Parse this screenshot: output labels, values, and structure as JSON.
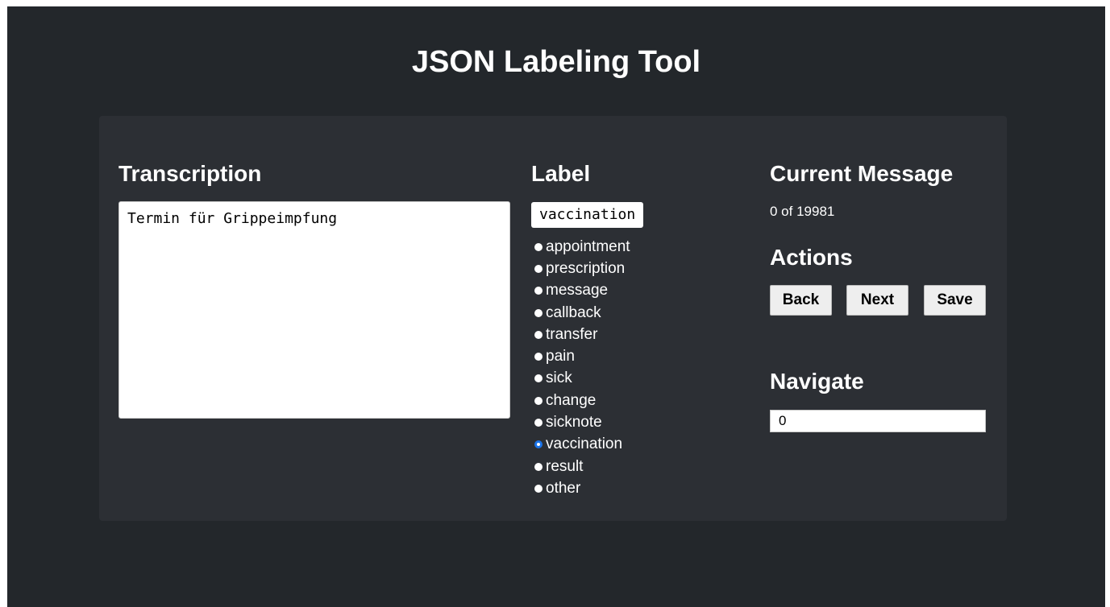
{
  "app": {
    "title": "JSON Labeling Tool"
  },
  "transcription": {
    "heading": "Transcription",
    "text": "Termin für Grippeimpfung"
  },
  "label": {
    "heading": "Label",
    "current_value": "vaccination",
    "options": [
      {
        "label": "appointment",
        "checked": false
      },
      {
        "label": "prescription",
        "checked": false
      },
      {
        "label": "message",
        "checked": false
      },
      {
        "label": "callback",
        "checked": false
      },
      {
        "label": "transfer",
        "checked": false
      },
      {
        "label": "pain",
        "checked": false
      },
      {
        "label": "sick",
        "checked": false
      },
      {
        "label": "change",
        "checked": false
      },
      {
        "label": "sicknote",
        "checked": false
      },
      {
        "label": "vaccination",
        "checked": true
      },
      {
        "label": "result",
        "checked": false
      },
      {
        "label": "other",
        "checked": false
      }
    ]
  },
  "current_message": {
    "heading": "Current Message",
    "counter": "0 of 19981"
  },
  "actions": {
    "heading": "Actions",
    "back_label": "Back",
    "next_label": "Next",
    "save_label": "Save"
  },
  "navigate": {
    "heading": "Navigate",
    "value": "0"
  },
  "colors": {
    "page_bg": "#23272b",
    "panel_bg": "#2c2f34",
    "radio_accent": "#1a73e8"
  }
}
